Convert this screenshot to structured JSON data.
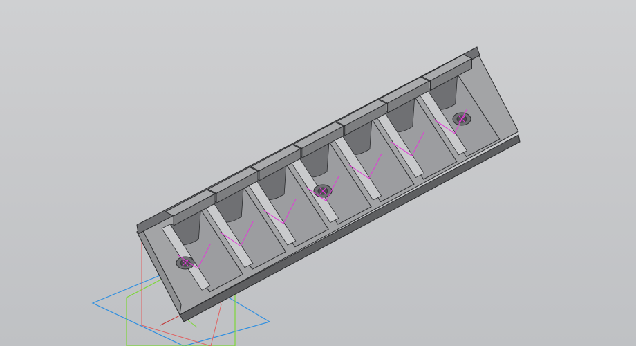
{
  "viewport": {
    "background_top": "#cfd0d2",
    "background_bottom": "#bfc1c4"
  },
  "model": {
    "name": "",
    "slot_count": 7,
    "screw_holes": 3,
    "colors": {
      "top": "#aaabad",
      "front": "#7d7e80",
      "side": "#8e8f91",
      "rib": "#c9cacc",
      "pocket_dark": "#6f7073",
      "pocket_light": "#9c9da0",
      "edge": "#2a2b2d",
      "sketch": "#e23bd8"
    }
  },
  "axes": {
    "icons": [
      "xy-plane",
      "yz-plane",
      "xz-plane",
      "origin-triad"
    ],
    "colors": {
      "xy_plane": "#2f8fe0",
      "xz_plane": "#7ed63a",
      "yz_plane": "#e06060",
      "origin": "#c03030"
    }
  }
}
